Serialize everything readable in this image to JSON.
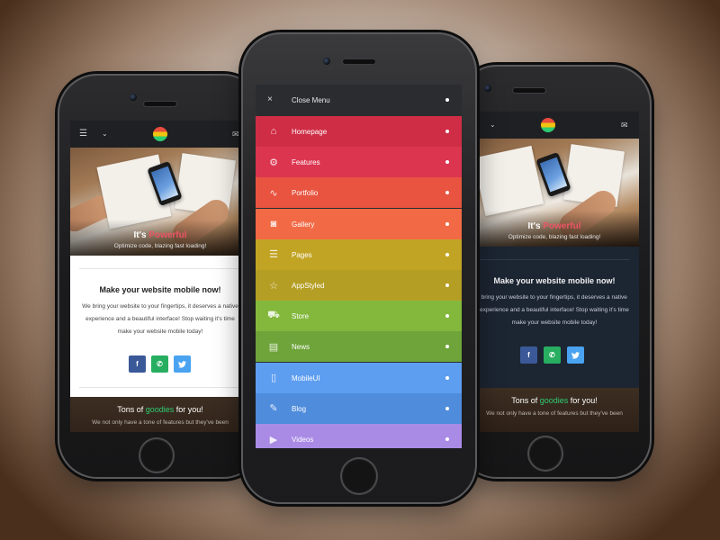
{
  "left_phone": {
    "topbar": {
      "menu_icon": "hamburger-icon",
      "dropdown_icon": "chevron-down-icon",
      "mail_icon": "mail-icon"
    },
    "hero": {
      "title_prefix": "It's ",
      "title_accent": "Powerful",
      "subtitle": "Optimize code, blazing fast loading!"
    },
    "card": {
      "title": "Make your website mobile now!",
      "line1": "We bring your website to your fingertips, it deserves a native",
      "line2": "experience and a beautiful interface! Stop waiting it's time",
      "line3": "make your website mobile today!"
    },
    "social": {
      "facebook": "f",
      "phone": "✆",
      "twitter": "🐦"
    },
    "bottom": {
      "title_prefix": "Tons of ",
      "title_accent": "goodies",
      "title_suffix": " for you!",
      "subtitle": "We not only have a tone of features but they've been"
    }
  },
  "right_phone": {
    "topbar": {
      "dropdown_icon": "chevron-down-icon",
      "mail_icon": "mail-icon"
    },
    "hero": {
      "title_prefix": "It's ",
      "title_accent": "Powerful",
      "subtitle": "Optimize code, blazing fast loading!"
    },
    "card": {
      "title": "Make your website mobile now!",
      "line1": "e bring your website to your fingertips, it deserves a native",
      "line2": "experience and a beautiful interface! Stop waiting it's time",
      "line3": "make your website mobile today!"
    },
    "social": {
      "facebook": "f",
      "phone": "✆",
      "twitter": "🐦"
    },
    "bottom": {
      "title_prefix": "Tons of ",
      "title_accent": "goodies",
      "title_suffix": " for you!",
      "subtitle": "We not only have a tone of features but they've been"
    }
  },
  "menu": {
    "close_label": "Close Menu",
    "close_icon": "×",
    "items": [
      {
        "label": "Homepage",
        "icon": "⌂",
        "icon_name": "home-icon",
        "color": "#cf2d45"
      },
      {
        "label": "Features",
        "icon": "⚙",
        "icon_name": "gear-icon",
        "color": "#dc3550"
      },
      {
        "label": "Portfolio",
        "icon": "∿",
        "icon_name": "chart-line-icon",
        "color": "#e8543f"
      },
      {
        "label": "Gallery",
        "icon": "◙",
        "icon_name": "camera-icon",
        "color": "#f26a45"
      },
      {
        "label": "Pages",
        "icon": "☰",
        "icon_name": "document-icon",
        "color": "#c2a425"
      },
      {
        "label": "AppStyled",
        "icon": "☆",
        "icon_name": "star-icon",
        "color": "#b59e24"
      },
      {
        "label": "Store",
        "icon": "⛟",
        "icon_name": "cart-icon",
        "color": "#83b83d"
      },
      {
        "label": "News",
        "icon": "▤",
        "icon_name": "news-icon",
        "color": "#6ea43a"
      },
      {
        "label": "MobileUI",
        "icon": "▯",
        "icon_name": "mobile-icon",
        "color": "#5e9ef0"
      },
      {
        "label": "Blog",
        "icon": "✎",
        "icon_name": "edit-icon",
        "color": "#4f8cdc"
      },
      {
        "label": "Videos",
        "icon": "▶",
        "icon_name": "video-icon",
        "color": "#a98be6"
      }
    ]
  },
  "colors": {
    "powerful_accent": "#ed5565",
    "goodies_accent": "#2ecc71",
    "light_card_bg": "#ffffff",
    "dark_card_bg": "#1c2532",
    "menu_header_bg": "#2b2c30"
  }
}
